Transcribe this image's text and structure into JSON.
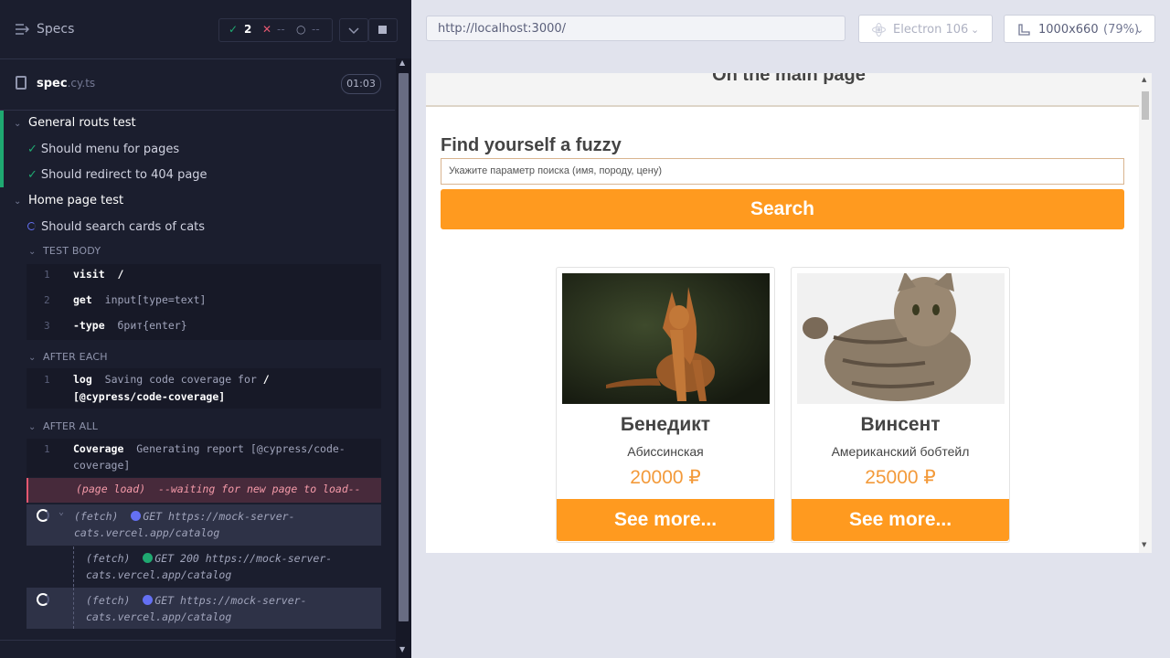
{
  "reporter": {
    "title": "Specs",
    "stats": {
      "passed": "2",
      "failed": "--",
      "pending": "--"
    },
    "spec": {
      "name": "spec",
      "ext": ".cy.ts",
      "time": "01:03"
    },
    "suites": [
      {
        "title": "General routs test",
        "tests": [
          "Should menu for pages",
          "Should redirect to 404 page"
        ]
      },
      {
        "title": "Home page test",
        "tests": [
          "Should search cards of cats"
        ]
      }
    ],
    "test_body_label": "TEST BODY",
    "test_body": [
      {
        "num": "1",
        "cmd": "visit",
        "arg": "/"
      },
      {
        "num": "2",
        "cmd": "get",
        "arg": "input[type=text]"
      },
      {
        "num": "3",
        "cmd": "-type",
        "arg": "брит{enter}"
      }
    ],
    "after_each_label": "AFTER EACH",
    "after_each": {
      "num": "1",
      "cmd": "log",
      "arg": "Saving code coverage for",
      "arg2": "/",
      "arg3": "[@cypress/code-coverage]"
    },
    "after_all_label": "AFTER ALL",
    "after_all": {
      "num": "1",
      "cmd": "Coverage",
      "arg": "Generating report [@cypress/code-",
      "arg2": "coverage]"
    },
    "page_load": {
      "label": "(page load)",
      "text": "--waiting for new page to load--"
    },
    "fetches": [
      {
        "label": "(fetch)",
        "text1": "GET https://mock-server-",
        "text2": "cats.vercel.app/catalog"
      },
      {
        "label": "(fetch)",
        "text1": "GET 200 https://mock-server-",
        "text2": "cats.vercel.app/catalog"
      },
      {
        "label": "(fetch)",
        "text1": "GET https://mock-server-",
        "text2": "cats.vercel.app/catalog"
      }
    ]
  },
  "browser": {
    "url": "http://localhost:3000/",
    "name": "Electron 106",
    "viewport": "1000x660",
    "zoom": "(79%)"
  },
  "app": {
    "header": "On the main page",
    "find_title": "Find yourself a fuzzy",
    "search_placeholder": "Укажите параметр поиска (имя, породу, цену)",
    "search_button": "Search",
    "cards": [
      {
        "name": "Бенедикт",
        "breed": "Абиссинская",
        "price": "20000 ₽",
        "button": "See more..."
      },
      {
        "name": "Винсент",
        "breed": "Американский бобтейл",
        "price": "25000 ₽",
        "button": "See more..."
      }
    ]
  },
  "colors": {
    "accent": "#ff9a1f",
    "pass": "#1fa971",
    "running": "#6470f3",
    "dark_bg": "#1b1e2e"
  }
}
